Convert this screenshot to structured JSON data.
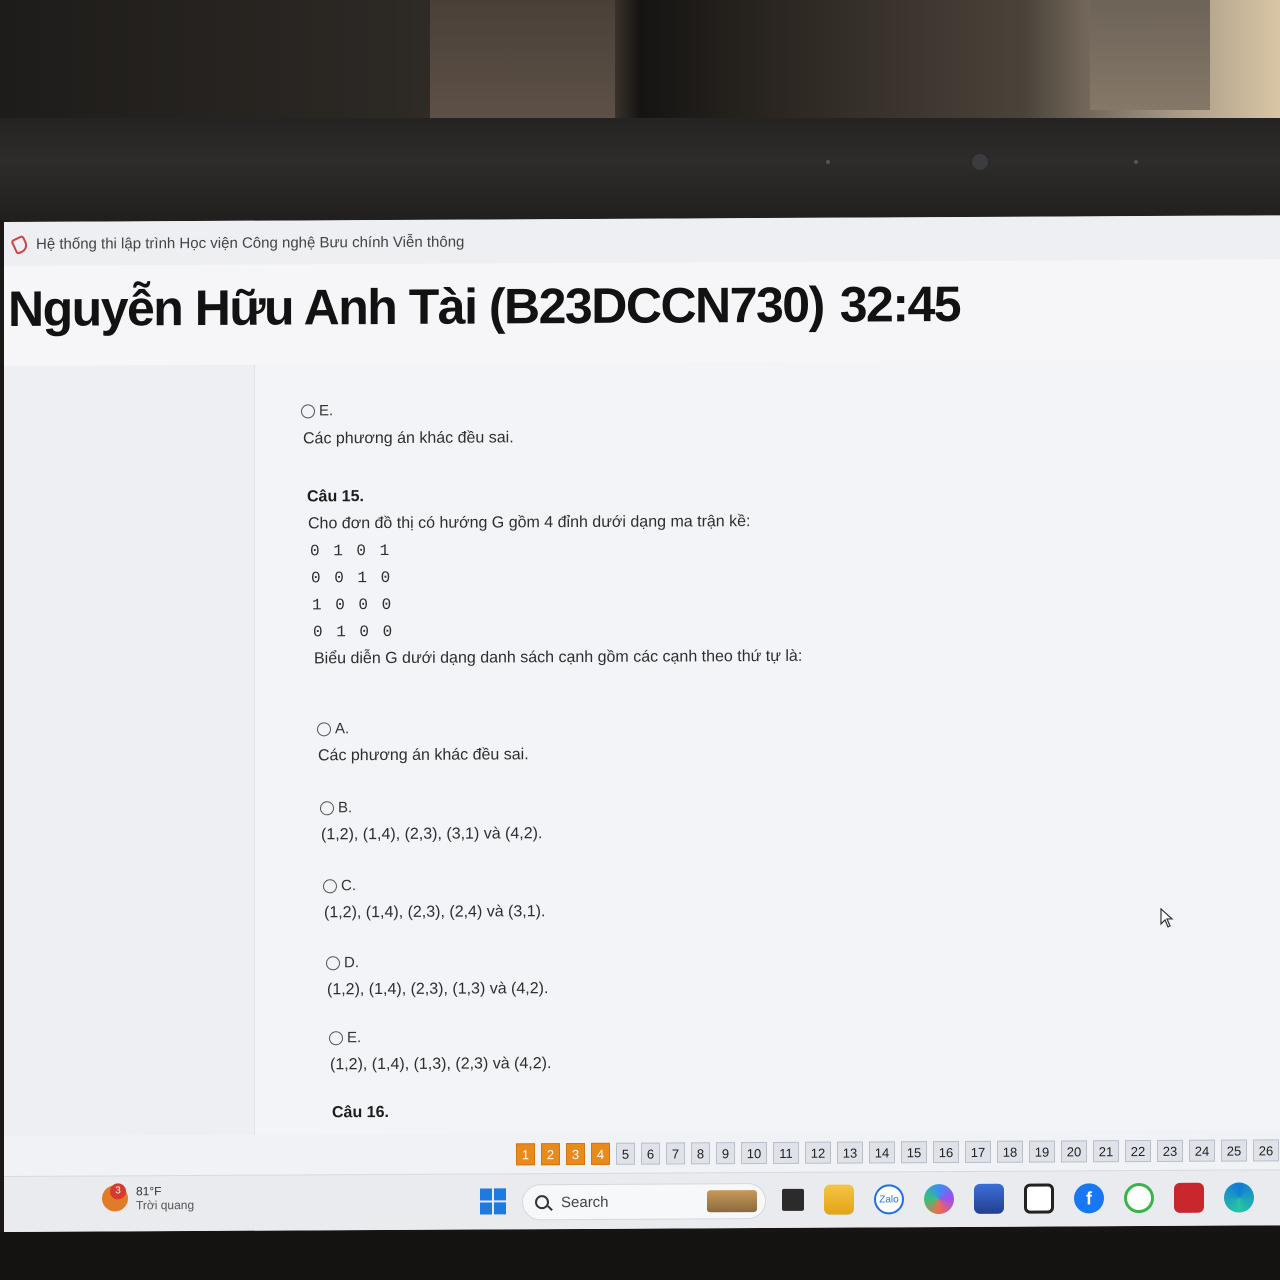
{
  "window": {
    "title": "Hệ thống thi lập trình Học viện Công nghệ Bưu chính Viễn thông"
  },
  "header": {
    "student": "Nguyễn Hữu Anh Tài (B23DCCN730)",
    "timer": "32:45"
  },
  "prev_option": {
    "label": "E.",
    "text": "Các phương án khác đều sai."
  },
  "question15": {
    "title": "Câu 15.",
    "intro": "Cho đơn đồ thị có hướng G gồm 4 đỉnh dưới dạng ma trận kề:",
    "matrix": [
      "0 1 0 1",
      "0 0 1 0",
      "1 0 0 0",
      "0 1 0 0"
    ],
    "prompt": "Biểu diễn G dưới dạng danh sách cạnh gồm các cạnh theo thứ tự là:",
    "options": [
      {
        "label": "A.",
        "text": "Các phương án khác đều sai."
      },
      {
        "label": "B.",
        "text": "(1,2), (1,4), (2,3), (3,1) và (4,2)."
      },
      {
        "label": "C.",
        "text": "(1,2), (1,4), (2,3), (2,4) và (3,1)."
      },
      {
        "label": "D.",
        "text": "(1,2), (1,4), (2,3), (1,3) và (4,2)."
      },
      {
        "label": "E.",
        "text": "(1,2), (1,4), (1,3), (2,3) và (4,2)."
      }
    ]
  },
  "question16": {
    "title": "Câu 16."
  },
  "pagination": {
    "answered": [
      "1",
      "2",
      "3",
      "4"
    ],
    "pages": [
      "5",
      "6",
      "7",
      "8",
      "9",
      "10",
      "11",
      "12",
      "13",
      "14",
      "15",
      "16",
      "17",
      "18",
      "19",
      "20",
      "21",
      "22",
      "23",
      "24",
      "25",
      "26"
    ]
  },
  "taskbar": {
    "weather_badge": "3",
    "temperature": "81°F",
    "condition": "Trời quang",
    "search_placeholder": "Search",
    "icons": [
      "taskview-icon",
      "file-explorer-icon",
      "zalo-icon",
      "copilot-icon",
      "store-icon",
      "xbox-icon",
      "facebook-icon",
      "wechat-icon",
      "screen-recorder-icon",
      "edge-icon"
    ],
    "zalo_label": "Zalo"
  },
  "colors": {
    "answered_page": "#e98a1d",
    "page_default": "#dfe2e8",
    "windows_blue": "#1f7ae0"
  }
}
